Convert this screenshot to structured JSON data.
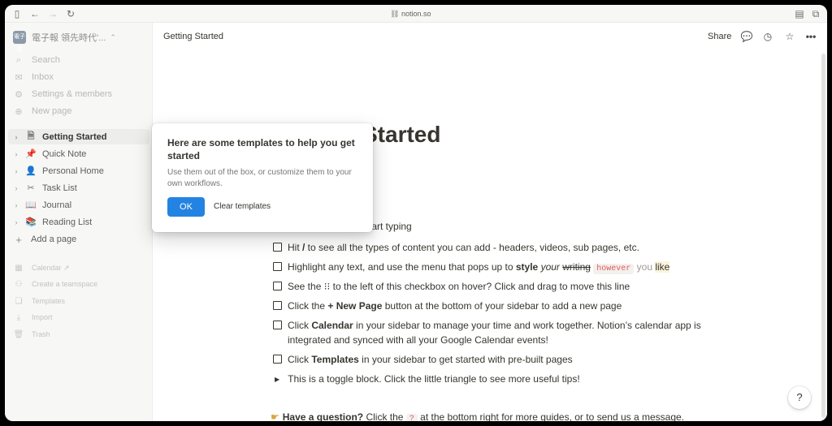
{
  "browser": {
    "url": "notion.so"
  },
  "workspace": {
    "name": "電子報 領先時代'...",
    "logo_text": "電子報"
  },
  "sidebar": {
    "nav": [
      {
        "label": "Search",
        "icon": "search-icon"
      },
      {
        "label": "Inbox",
        "icon": "inbox-icon"
      },
      {
        "label": "Settings & members",
        "icon": "gear-icon"
      },
      {
        "label": "New page",
        "icon": "plus-circle-icon"
      }
    ],
    "pages": [
      {
        "label": "Getting Started",
        "icon": "page-icon",
        "active": true
      },
      {
        "label": "Quick Note",
        "icon": "pushpin-icon"
      },
      {
        "label": "Personal Home",
        "icon": "person-icon"
      },
      {
        "label": "Task List",
        "icon": "scissors-icon"
      },
      {
        "label": "Journal",
        "icon": "book-icon"
      },
      {
        "label": "Reading List",
        "icon": "books-icon"
      }
    ],
    "add_page": "Add a page",
    "lower": [
      {
        "label": "Calendar ↗",
        "icon": "calendar-icon"
      },
      {
        "label": "Create a teamspace",
        "icon": "teamspace-icon"
      },
      {
        "label": "Templates",
        "icon": "templates-icon"
      },
      {
        "label": "Import",
        "icon": "import-icon"
      },
      {
        "label": "Trash",
        "icon": "trash-icon"
      }
    ]
  },
  "topbar": {
    "breadcrumb": "Getting Started",
    "share": "Share"
  },
  "page": {
    "title_visible": "Started",
    "partial_line": "l just start typing",
    "todos": [
      {
        "parts": [
          "Hit ",
          "/",
          " to see all the types of content you can add - headers, videos, sub pages, etc."
        ]
      },
      {
        "parts": [
          "Highlight any text, and use the menu that pops up to ",
          "style",
          " ",
          "your",
          " ",
          "writing",
          " ",
          "however",
          " ",
          "you",
          " ",
          "like"
        ]
      },
      {
        "parts": [
          "See the ⁝⁝ to the left of this checkbox on hover? Click and drag to move this line"
        ]
      },
      {
        "parts": [
          "Click the ",
          "+ New Page",
          " button at the bottom of your sidebar to add a new page"
        ]
      },
      {
        "parts": [
          "Click ",
          "Calendar",
          " in your sidebar to manage your time and work together. Notion’s calendar app is integrated and synced with all your Google Calendar events!"
        ]
      },
      {
        "parts": [
          "Click ",
          "Templates",
          " in your sidebar to get started with pre-built pages"
        ]
      }
    ],
    "toggle": "This is a toggle block. Click the little triangle to see more useful tips!",
    "question": {
      "bold": "Have a question?",
      "pre": " Click the ",
      "code": "?",
      "post": " at the bottom right for more guides, or to send us a message."
    },
    "help": "?"
  },
  "popup": {
    "title": "Here are some templates to help you get started",
    "description": "Use them out of the box, or customize them to your own workflows.",
    "ok": "OK",
    "clear": "Clear templates"
  },
  "colors": {
    "accent": "#2383e2",
    "code_red": "#eb5757",
    "sidebar_bg": "#f7f7f5",
    "text": "#37352f"
  }
}
